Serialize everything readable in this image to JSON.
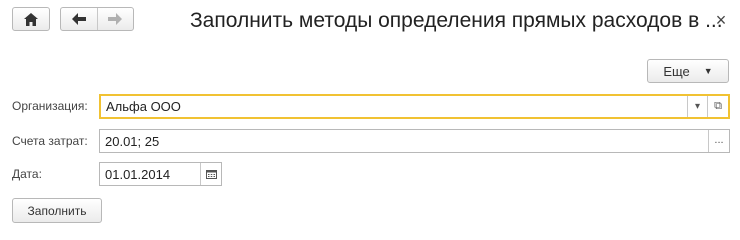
{
  "toolbar": {
    "home_icon": "home-icon",
    "back_icon": "arrow-left-icon",
    "forward_icon": "arrow-right-icon"
  },
  "window": {
    "title": "Заполнить методы определения прямых расходов в ...",
    "close_glyph": "×"
  },
  "more_button": {
    "label": "Еще",
    "caret": "▼"
  },
  "form": {
    "organization": {
      "label": "Организация:",
      "value": "Альфа ООО",
      "dropdown_glyph": "▾",
      "open_glyph": "⧉"
    },
    "accounts": {
      "label": "Счета затрат:",
      "value": "20.01; 25",
      "select_glyph": "..."
    },
    "date": {
      "label": "Дата:",
      "value": "01.01.2014"
    }
  },
  "fill_button": {
    "label": "Заполнить"
  },
  "colors": {
    "focus_border": "#f1c232",
    "border": "#b8b8b8"
  }
}
